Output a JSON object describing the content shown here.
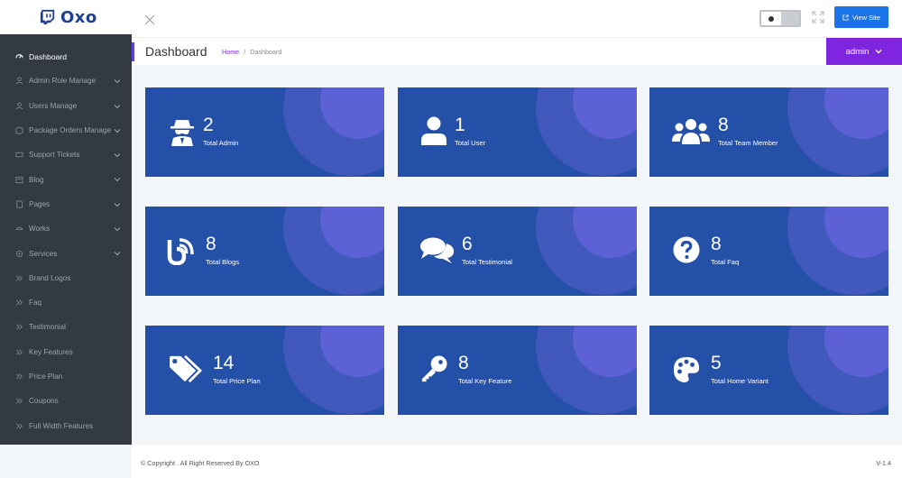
{
  "brand": {
    "name": "Oxo"
  },
  "sidebar": {
    "items": [
      {
        "label": "Dashboard",
        "icon": "gauge-icon",
        "active": true,
        "has_submenu": false
      },
      {
        "label": "Admin Role Manage",
        "icon": "user-shield-icon",
        "has_submenu": true
      },
      {
        "label": "Users Manage",
        "icon": "user-icon",
        "has_submenu": true
      },
      {
        "label": "Package Orders Manage",
        "icon": "box-icon",
        "has_submenu": true
      },
      {
        "label": "Support Tickets",
        "icon": "ticket-icon",
        "has_submenu": true
      },
      {
        "label": "Blog",
        "icon": "blog-icon",
        "has_submenu": true
      },
      {
        "label": "Pages",
        "icon": "pages-icon",
        "has_submenu": true
      },
      {
        "label": "Works",
        "icon": "works-icon",
        "has_submenu": true
      },
      {
        "label": "Services",
        "icon": "services-icon",
        "has_submenu": true
      },
      {
        "label": "Brand Logos",
        "icon": "double-chevron-icon",
        "has_submenu": false
      },
      {
        "label": "Faq",
        "icon": "double-chevron-icon",
        "has_submenu": false
      },
      {
        "label": "Testimonial",
        "icon": "double-chevron-icon",
        "has_submenu": false
      },
      {
        "label": "Key Features",
        "icon": "double-chevron-icon",
        "has_submenu": false
      },
      {
        "label": "Price Plan",
        "icon": "double-chevron-icon",
        "has_submenu": false
      },
      {
        "label": "Coupons",
        "icon": "double-chevron-icon",
        "has_submenu": false
      },
      {
        "label": "Full Width Features",
        "icon": "double-chevron-icon",
        "has_submenu": false
      }
    ]
  },
  "header": {
    "view_site_label": "View Site",
    "admin_label": "admin"
  },
  "page": {
    "title": "Dashboard",
    "breadcrumb_home": "Home",
    "breadcrumb_separator": "/",
    "breadcrumb_current": "Dashboard"
  },
  "cards": [
    {
      "count": "2",
      "label": "Total Admin",
      "icon": "spy-icon"
    },
    {
      "count": "1",
      "label": "Total User",
      "icon": "user-icon"
    },
    {
      "count": "8",
      "label": "Total Team Member",
      "icon": "users-icon"
    },
    {
      "count": "8",
      "label": "Total Blogs",
      "icon": "blog-icon"
    },
    {
      "count": "6",
      "label": "Total Testimonial",
      "icon": "comments-icon"
    },
    {
      "count": "8",
      "label": "Total Faq",
      "icon": "question-circle-icon"
    },
    {
      "count": "14",
      "label": "Total Price Plan",
      "icon": "tags-icon"
    },
    {
      "count": "8",
      "label": "Total Key Feature",
      "icon": "key-icon"
    },
    {
      "count": "5",
      "label": "Total Home Variant",
      "icon": "palette-icon"
    }
  ],
  "footer": {
    "copyright": "© Copyright . All Right Reserved By OXO",
    "version": "V-1.4"
  },
  "colors": {
    "sidebar_bg": "#343a44",
    "card_bg": "#2450a7",
    "accent_purple": "#7f25e0",
    "view_site_blue": "#1a73e8"
  }
}
